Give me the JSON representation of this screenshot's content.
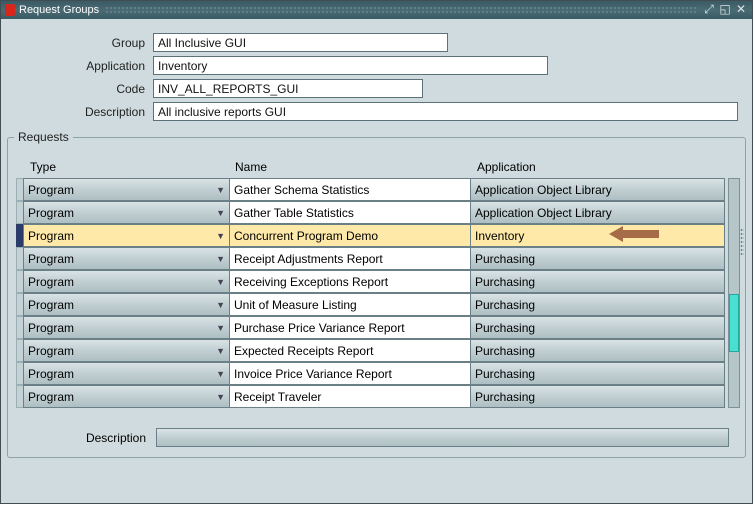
{
  "window": {
    "title": "Request Groups"
  },
  "form": {
    "labels": {
      "group": "Group",
      "application": "Application",
      "code": "Code",
      "description": "Description"
    },
    "values": {
      "group": "All Inclusive GUI",
      "application": "Inventory",
      "code": "INV_ALL_REPORTS_GUI",
      "description": "All inclusive reports GUI"
    }
  },
  "requests": {
    "legend": "Requests",
    "columns": {
      "type": "Type",
      "name": "Name",
      "application": "Application"
    },
    "rows": [
      {
        "type": "Program",
        "name": "Gather Schema Statistics",
        "application": "Application Object Library",
        "selected": false
      },
      {
        "type": "Program",
        "name": "Gather Table Statistics",
        "application": "Application Object Library",
        "selected": false
      },
      {
        "type": "Program",
        "name": "Concurrent Program Demo",
        "application": "Inventory",
        "selected": true
      },
      {
        "type": "Program",
        "name": "Receipt Adjustments Report",
        "application": "Purchasing",
        "selected": false
      },
      {
        "type": "Program",
        "name": "Receiving Exceptions Report",
        "application": "Purchasing",
        "selected": false
      },
      {
        "type": "Program",
        "name": "Unit of Measure Listing",
        "application": "Purchasing",
        "selected": false
      },
      {
        "type": "Program",
        "name": "Purchase Price Variance Report",
        "application": "Purchasing",
        "selected": false
      },
      {
        "type": "Program",
        "name": "Expected Receipts Report",
        "application": "Purchasing",
        "selected": false
      },
      {
        "type": "Program",
        "name": "Invoice Price Variance Report",
        "application": "Purchasing",
        "selected": false
      },
      {
        "type": "Program",
        "name": "Receipt Traveler",
        "application": "Purchasing",
        "selected": false
      }
    ],
    "bottom_description_label": "Description",
    "bottom_description_value": ""
  }
}
